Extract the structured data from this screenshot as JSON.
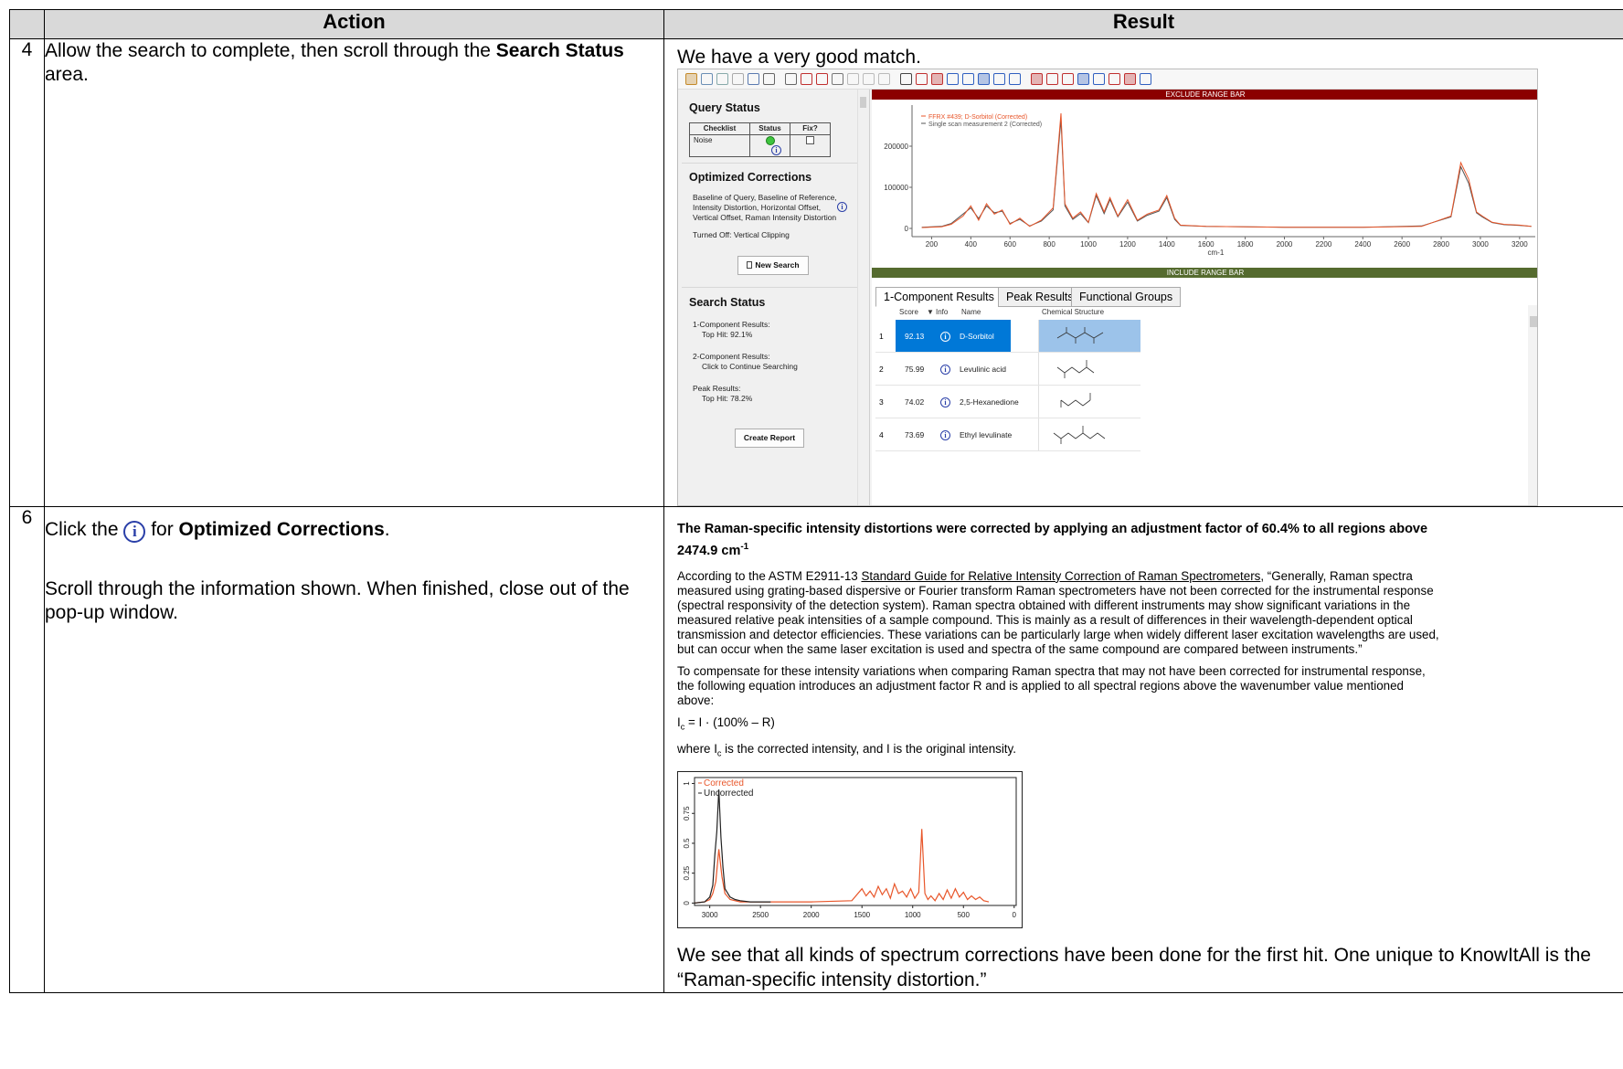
{
  "table": {
    "headers": [
      "Action",
      "Result"
    ],
    "rows": [
      {
        "step": "4",
        "action_pre": "Allow the search to complete, then scroll through the ",
        "action_bold": "Search Status",
        "action_post": " area.",
        "result_text": "We have a very good match."
      },
      {
        "step": "6",
        "action_a_pre": "Click the ",
        "action_a_mid": " for ",
        "action_a_bold": "Optimized Corrections",
        "action_a_post": ".",
        "action_b": "Scroll through the information shown.  When finished, close out of the pop-up window.",
        "result_final": "We see that all kinds of spectrum corrections have been done for the first hit. One unique to KnowItAll is the “Raman-specific intensity distortion.”"
      }
    ]
  },
  "app": {
    "query_status": {
      "title": "Query Status",
      "headers": [
        "Checklist",
        "Status",
        "Fix?"
      ],
      "row": "Noise"
    },
    "optimized": {
      "title": "Optimized Corrections",
      "lines": [
        "Baseline of Query, Baseline of Reference,",
        "Intensity Distortion, Horizontal Offset,",
        "Vertical Offset, Raman Intensity Distortion"
      ],
      "turned_off": "Turned Off: Vertical Clipping",
      "new_search": "New Search"
    },
    "search_status": {
      "title": "Search Status",
      "one_comp": "1-Component Results:",
      "one_comp_hit": "Top Hit: 92.1%",
      "two_comp": "2-Component Results:",
      "two_comp_hit": "Click to Continue Searching",
      "peak": "Peak Results:",
      "peak_hit": "Top Hit: 78.2%",
      "create_report": "Create Report"
    },
    "exclude_bar": "EXCLUDE RANGE BAR",
    "include_bar": "INCLUDE RANGE BAR",
    "tabs": [
      "1-Component Results",
      "Peak Results",
      "Functional Groups"
    ],
    "result_headers": [
      "Score",
      "Info",
      "Name",
      "Chemical Structure"
    ],
    "results": [
      {
        "rank": "1",
        "score": "92.13",
        "name": "D-Sorbitol"
      },
      {
        "rank": "2",
        "score": "75.99",
        "name": "Levulinic acid"
      },
      {
        "rank": "3",
        "score": "74.02",
        "name": "2,5-Hexanedione"
      },
      {
        "rank": "4",
        "score": "73.69",
        "name": "Ethyl levulinate"
      }
    ],
    "colors": {
      "exclude": "#8b0000",
      "include": "#556b2f",
      "selected": "#0078d7",
      "corrected": "#e8562a"
    }
  },
  "popup": {
    "title": "The Raman-specific intensity distortions were corrected by applying an adjustment factor of 60.4% to all regions above 2474.9 cm",
    "title_sup": "-1",
    "p1_pre": "According to the ASTM E2911-13 ",
    "p1_link": "Standard Guide for Relative Intensity Correction of Raman Spectrometers",
    "p1_post": ", “Generally, Raman spectra measured using grating-based dispersive or Fourier transform Raman spectrometers have not been corrected for the instrumental response (spectral responsivity of the detection system). Raman spectra obtained with different instruments may show significant variations in the measured relative peak intensities of a sample compound. This is mainly as a result of differences in their wavelength-dependent optical transmission and detector efficiencies. These variations can be particularly large when widely different laser excitation wavelengths are used, but can occur when the same laser excitation is used and spectra of the same compound are compared between instruments.”",
    "p2": "To compensate for these intensity variations when comparing Raman spectra that may not have been corrected for instrumental response, the following equation introduces an adjustment factor R and is applied to all spectral regions above the wavenumber value mentioned above:",
    "eq_i": "I",
    "eq_sub": "c",
    "eq_rest": " = I · (100% – R)",
    "where_pre": "where I",
    "where_sub": "c",
    "where_post": " is the corrected intensity, and I is the original intensity."
  },
  "chart_data": [
    {
      "type": "line",
      "title": "",
      "xlabel": "cm-1",
      "x_ticks": [
        200,
        400,
        600,
        800,
        1000,
        1200,
        1400,
        1600,
        1800,
        2000,
        2200,
        2400,
        2600,
        2800,
        3000,
        3200
      ],
      "y_ticks": [
        0,
        100000,
        200000
      ],
      "xlim": [
        100,
        3280
      ],
      "ylim": [
        -20000,
        300000
      ],
      "series": [
        {
          "name": "FFRX #439; D-Sorbitol  (Corrected)",
          "color": "#e8562a",
          "x": [
            150,
            250,
            300,
            360,
            400,
            440,
            480,
            520,
            560,
            600,
            650,
            700,
            760,
            820,
            860,
            880,
            920,
            960,
            1000,
            1040,
            1080,
            1110,
            1150,
            1200,
            1250,
            1300,
            1360,
            1400,
            1440,
            1470,
            1600,
            2000,
            2400,
            2700,
            2850,
            2900,
            2940,
            2980,
            3010,
            3060,
            3120,
            3200,
            3260
          ],
          "y": [
            2000,
            4000,
            10000,
            30000,
            55000,
            20000,
            60000,
            35000,
            45000,
            10000,
            25000,
            5000,
            20000,
            50000,
            280000,
            60000,
            25000,
            40000,
            15000,
            85000,
            40000,
            75000,
            30000,
            70000,
            20000,
            35000,
            45000,
            80000,
            25000,
            8000,
            5000,
            3000,
            3000,
            5000,
            30000,
            160000,
            120000,
            40000,
            30000,
            15000,
            10000,
            8000,
            5000
          ]
        },
        {
          "name": "Single scan measurement 2 (Corrected)",
          "color": "#555555",
          "x": [
            150,
            250,
            300,
            360,
            400,
            440,
            480,
            520,
            560,
            600,
            650,
            700,
            760,
            820,
            860,
            880,
            920,
            960,
            1000,
            1040,
            1080,
            1110,
            1150,
            1200,
            1250,
            1300,
            1360,
            1400,
            1440,
            1470,
            1600,
            2000,
            2400,
            2700,
            2850,
            2900,
            2940,
            2980,
            3010,
            3060,
            3120,
            3200,
            3260
          ],
          "y": [
            3000,
            5000,
            12000,
            35000,
            50000,
            24000,
            55000,
            38000,
            42000,
            12000,
            22000,
            6000,
            18000,
            45000,
            265000,
            55000,
            22000,
            36000,
            14000,
            80000,
            36000,
            70000,
            28000,
            64000,
            18000,
            32000,
            42000,
            75000,
            22000,
            7000,
            5000,
            3000,
            3000,
            6000,
            28000,
            150000,
            110000,
            38000,
            28000,
            14000,
            9000,
            7000,
            5000
          ]
        }
      ]
    },
    {
      "type": "line",
      "title": "",
      "x_ticks": [
        3000,
        2500,
        2000,
        1500,
        1000,
        500,
        0
      ],
      "y_ticks": [
        0,
        0.25,
        0.5,
        0.75,
        1
      ],
      "xlim": [
        3150,
        -20
      ],
      "ylim": [
        -0.02,
        1.05
      ],
      "series": [
        {
          "name": "Corrected",
          "color": "#e8562a",
          "x": [
            3150,
            3050,
            3000,
            2970,
            2940,
            2910,
            2880,
            2850,
            2800,
            2700,
            2500,
            2000,
            1600,
            1500,
            1460,
            1420,
            1380,
            1340,
            1300,
            1260,
            1220,
            1180,
            1140,
            1100,
            1060,
            1020,
            980,
            940,
            910,
            880,
            850,
            820,
            780,
            740,
            700,
            660,
            620,
            580,
            540,
            500,
            460,
            420,
            380,
            340,
            300,
            250
          ],
          "y": [
            0.0,
            0.01,
            0.03,
            0.08,
            0.18,
            0.45,
            0.22,
            0.08,
            0.03,
            0.01,
            0.01,
            0.01,
            0.02,
            0.12,
            0.06,
            0.1,
            0.05,
            0.14,
            0.07,
            0.12,
            0.04,
            0.16,
            0.08,
            0.1,
            0.05,
            0.12,
            0.04,
            0.09,
            0.62,
            0.08,
            0.03,
            0.06,
            0.02,
            0.08,
            0.03,
            0.11,
            0.04,
            0.12,
            0.05,
            0.09,
            0.03,
            0.06,
            0.03,
            0.05,
            0.02,
            0.01
          ]
        },
        {
          "name": "Uncorrected",
          "color": "#222222",
          "x": [
            3150,
            3050,
            3000,
            2970,
            2950,
            2930,
            2910,
            2890,
            2870,
            2850,
            2800,
            2750,
            2700,
            2600,
            2400
          ],
          "y": [
            0.0,
            0.01,
            0.05,
            0.15,
            0.4,
            0.6,
            0.95,
            0.55,
            0.3,
            0.12,
            0.05,
            0.03,
            0.02,
            0.01,
            0.01
          ]
        }
      ]
    }
  ]
}
